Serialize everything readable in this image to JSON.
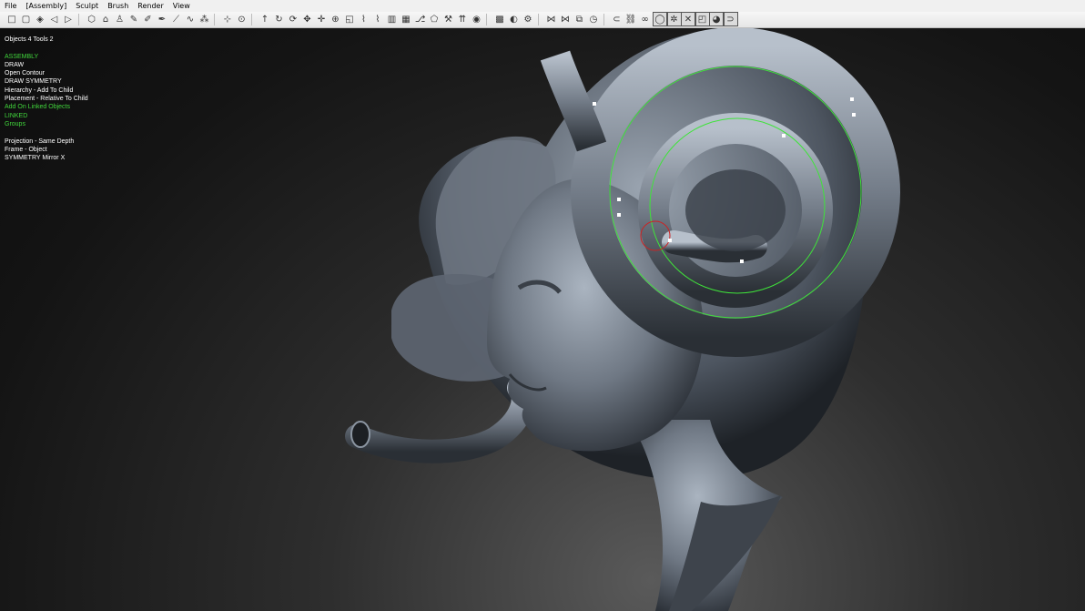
{
  "menu": {
    "items": [
      "File",
      "[Assembly]",
      "Sculpt",
      "Brush",
      "Render",
      "View"
    ]
  },
  "toolbar": {
    "groups": [
      [
        "new-icon",
        "box-icon",
        "sphere-icon",
        "arrow-left-icon",
        "arrow-right-icon"
      ],
      [
        "cube-icon",
        "house-icon",
        "figure-icon",
        "brush-icon",
        "brush2-icon",
        "pen-icon",
        "line-icon",
        "curve-icon",
        "spray-icon"
      ],
      [
        "pin-icon",
        "target-icon"
      ],
      [
        "arrow-up-icon",
        "rotate-icon",
        "rotate2-icon",
        "move-icon",
        "move2-icon",
        "move3-icon",
        "scale-icon",
        "eyedropper-icon",
        "eyedropper2-icon",
        "columns-icon",
        "grid-icon",
        "flow-icon",
        "shapes-icon",
        "tool-icon",
        "bars-icon",
        "circle-icon"
      ],
      [
        "checker-icon",
        "contrast-icon",
        "gear-icon"
      ],
      [
        "mirror-icon",
        "mirror2-icon",
        "frame-icon",
        "clock-icon"
      ],
      [
        "link-icon",
        "chain-icon",
        "link2-icon",
        "ring-icon",
        "symmetry-icon",
        "cross-icon",
        "square-icon",
        "material-icon",
        "loop-icon"
      ]
    ]
  },
  "overlay": {
    "counts": "Objects 4   Tools 2",
    "lines": [
      {
        "text": "ASSEMBLY",
        "color": "#41d63c"
      },
      {
        "text": "DRAW",
        "color": "#ffffff"
      },
      {
        "text": "Open Contour",
        "color": "#ffffff"
      },
      {
        "text": "DRAW SYMMETRY",
        "color": "#ffffff"
      },
      {
        "text": "Hierarchy - Add To Child",
        "color": "#ffffff"
      },
      {
        "text": "Placement - Relative To Child",
        "color": "#ffffff"
      },
      {
        "text": "Add On Linked Objects",
        "color": "#41d63c"
      },
      {
        "text": "LINKED",
        "color": "#41d63c"
      },
      {
        "text": "Groups",
        "color": "#41d63c"
      },
      {
        "text": "",
        "color": "#ffffff"
      },
      {
        "text": "Projection - Same Depth",
        "color": "#ffffff"
      },
      {
        "text": "Frame - Object",
        "color": "#ffffff"
      },
      {
        "text": "SYMMETRY   Mirror X",
        "color": "#ffffff"
      }
    ]
  },
  "colors": {
    "curve": "#3fe33a",
    "model_light": "#aab4c0",
    "model_dark": "#2c3138"
  }
}
